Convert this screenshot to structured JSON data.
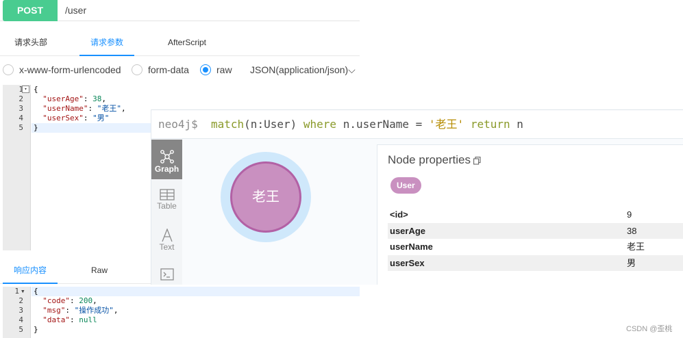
{
  "request": {
    "method": "POST",
    "url": "/user",
    "tabs": [
      "请求头部",
      "请求参数",
      "AfterScript"
    ],
    "active_tab": "请求参数",
    "body_types": [
      "x-www-form-urlencoded",
      "form-data",
      "raw"
    ],
    "selected_body_type": "raw",
    "content_type": "JSON(application/json)",
    "content_type_chevron": "⌵",
    "editor": {
      "line_numbers": [
        "1",
        "2",
        "3",
        "4",
        "5"
      ],
      "fold_marker": "▾",
      "line1": "{",
      "line2_key": "\"userAge\"",
      "line2_sep": ": ",
      "line2_val": "38",
      "line2_end": ",",
      "line3_key": "\"userName\"",
      "line3_sep": ": ",
      "line3_val": "\"老王\"",
      "line3_end": ",",
      "line4_key": "\"userSex\"",
      "line4_sep": ": ",
      "line4_val": "\"男\"",
      "line5": "}"
    }
  },
  "response": {
    "tabs": [
      "响应内容",
      "Raw"
    ],
    "active_tab": "响应内容",
    "editor": {
      "line_numbers": [
        "1",
        "2",
        "3",
        "4",
        "5"
      ],
      "fold_marker": "▾",
      "line1": "{",
      "line2_key": "\"code\"",
      "line2_sep": ": ",
      "line2_val": "200",
      "line2_end": ",",
      "line3_key": "\"msg\"",
      "line3_sep": ": ",
      "line3_val": "\"操作成功\"",
      "line3_end": ",",
      "line4_key": "\"data\"",
      "line4_sep": ": ",
      "line4_val": "null",
      "line5": "}"
    }
  },
  "neo4j": {
    "prompt": "neo4j$",
    "query": {
      "kw_match": "match",
      "pattern": "(n:User)",
      "kw_where": "where",
      "condition": "n.userName =",
      "string": "'老王'",
      "kw_return": "return",
      "ret": "n"
    },
    "side_buttons": [
      {
        "label": "Graph",
        "icon": "graph-icon",
        "active": true
      },
      {
        "label": "Table",
        "icon": "table-icon",
        "active": false
      },
      {
        "label": "Text",
        "icon": "text-icon",
        "active": false
      },
      {
        "label": "",
        "icon": "code-icon",
        "active": false
      }
    ],
    "node_caption": "老王",
    "node_color": "#c990c0",
    "node_border_color": "#b261a5",
    "properties": {
      "title": "Node properties",
      "copy_icon": "copy-icon",
      "label": "User",
      "rows": [
        {
          "key": "<id>",
          "value": "9"
        },
        {
          "key": "userAge",
          "value": "38"
        },
        {
          "key": "userName",
          "value": "老王"
        },
        {
          "key": "userSex",
          "value": "男"
        }
      ]
    }
  },
  "watermark": "CSDN @歪桃",
  "colors": {
    "post_green": "#49cc90",
    "accent_blue": "#1890ff"
  }
}
